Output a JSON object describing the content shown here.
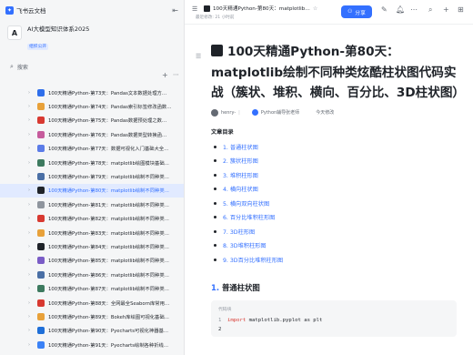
{
  "app": {
    "name": "飞书云文档"
  },
  "space": {
    "avatar_letter": "A",
    "name": "AI大模型知识体系2025",
    "tag": "组织公开"
  },
  "search": {
    "placeholder": "搜索"
  },
  "tree": [
    {
      "title": "100天精通Python-第73天：Pandas文本数据处理方…",
      "color": "#2f6feb"
    },
    {
      "title": "100天精通Python-第74天：Pandas索引标签修改函数…",
      "color": "#e8a13a"
    },
    {
      "title": "100天精通Python-第75天：Pandas数据预处理之数…",
      "color": "#d83931"
    },
    {
      "title": "100天精通Python-第76天：Pandas数据类型转换函…",
      "color": "#c65b9c"
    },
    {
      "title": "100天精通Python-第77天：数据可视化入门基础大全…",
      "color": "#5b7ce8"
    },
    {
      "title": "100天精通Python-第78天：matplotlib绘图模块基础…",
      "color": "#3d7a5f"
    },
    {
      "title": "100天精通Python-第79天：matplotlib绘制不同种类…",
      "color": "#4a6fa5"
    },
    {
      "title": "100天精通Python-第80天：matplotlib绘制不同种类…",
      "color": "#1f2329",
      "active": true
    },
    {
      "title": "100天精通Python-第81天：matplotlib绘制不同种类…",
      "color": "#8f959e"
    },
    {
      "title": "100天精通Python-第82天：matplotlib绘制不同种类…",
      "color": "#d83931"
    },
    {
      "title": "100天精通Python-第83天：matplotlib绘制不同种类…",
      "color": "#e8a13a"
    },
    {
      "title": "100天精通Python-第84天：matplotlib绘制不同种类…",
      "color": "#1f2329"
    },
    {
      "title": "100天精通Python-第85天：matplotlib绘制不同种类…",
      "color": "#7a5cc6"
    },
    {
      "title": "100天精通Python-第86天：matplotlib绘制不同种类…",
      "color": "#4a6fa5"
    },
    {
      "title": "100天精通Python-第87天：matplotlib绘制不同种类…",
      "color": "#3d7a5f"
    },
    {
      "title": "100天精通Python-第88天：全网最全Seaborn库常用…",
      "color": "#d83931"
    },
    {
      "title": "100天精通Python-第89天：Bokeh库绘图可视化基础…",
      "color": "#e8a13a"
    },
    {
      "title": "100天精通Python-第90天：Pyecharts可视化神器基…",
      "color": "#1f6fd8"
    },
    {
      "title": "100天精通Python-第91天：Pyecharts绘制各种折线…",
      "color": "#3b82f6"
    }
  ],
  "topbar": {
    "doc_title": "100天精通Python-第80天：matplotlib…",
    "subtitle": "最近修改: 21 小时前",
    "share_label": "分享"
  },
  "doc": {
    "title": "100天精通Python-第80天：matplotlib绘制不同种类炫酷柱状图代码实战（簇状、堆积、横向、百分比、3D柱状图）",
    "author": "henry-",
    "collaborator": "Python辅导张老师",
    "edited": "今天修改",
    "toc_heading": "文章目录",
    "toc": [
      "1. 普通柱状图",
      "2. 簇状柱形图",
      "3. 堆积柱形图",
      "4. 横向柱状图",
      "5. 横向双向柱状图",
      "6. 百分比堆积柱形图",
      "7. 3D柱形图",
      "8. 3D堆积柱形图",
      "9. 3D百分比堆积柱形图"
    ],
    "section1_num": "1.",
    "section1_title": "普通柱状图",
    "code_lang": "代码块",
    "code_line1": {
      "ln": "1",
      "kw": "import",
      "rest": " matplotlib.pyplot as plt"
    },
    "code_line2": {
      "ln": "2",
      "kw": "",
      "rest": ""
    }
  }
}
